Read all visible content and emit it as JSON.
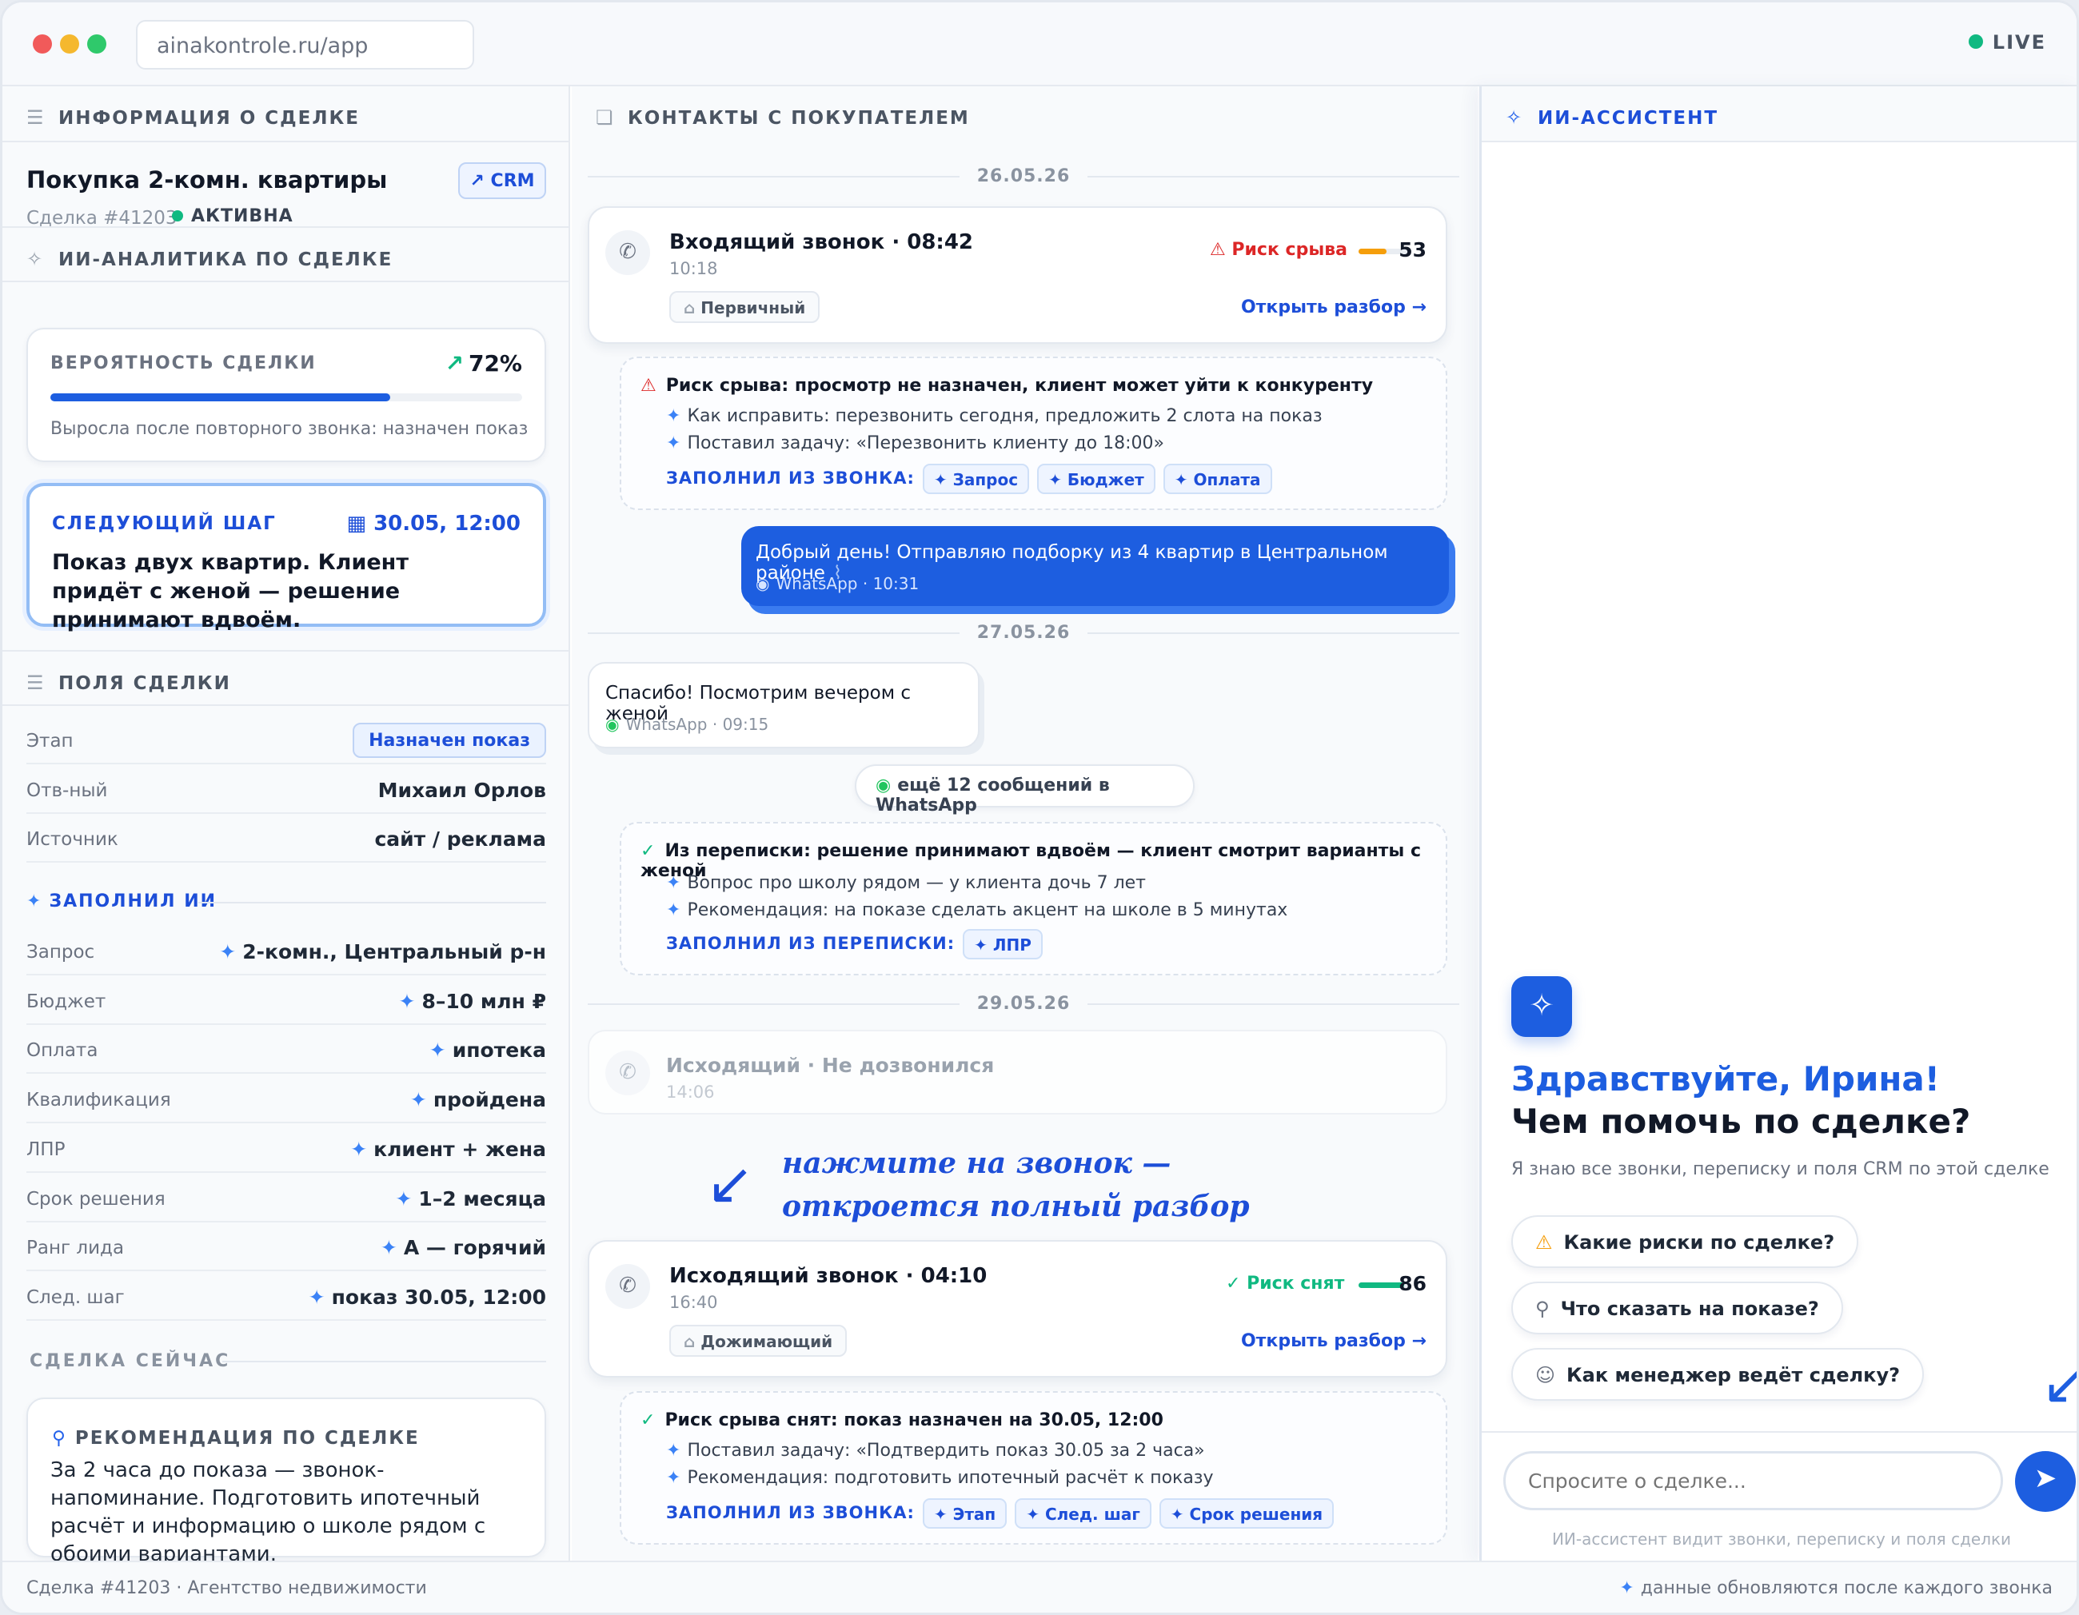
{
  "window": {
    "url": "ainakontrole.ru/app",
    "live_label": "LIVE"
  },
  "colors": {
    "accent": "#1d5ee0",
    "success": "#10b981",
    "danger": "#dc2626",
    "warning": "#f59e0b"
  },
  "left": {
    "header": "ИНФОРМАЦИЯ О СДЕЛКЕ",
    "deal_title": "Покупка 2-комн. квартиры",
    "crm_label": "CRM",
    "deal_number": "Сделка #41203",
    "status": "АКТИВНА",
    "analytics_header": "ИИ-АНАЛИТИКА ПО СДЕЛКЕ",
    "probability": {
      "label": "ВЕРОЯТНОСТЬ СДЕЛКИ",
      "value": "72%",
      "fraction": 0.72,
      "note": "Выросла после повторного звонка: назначен показ"
    },
    "next_step": {
      "label": "СЛЕДУЮЩИЙ ШАГ",
      "date": "30.05, 12:00",
      "text": "Показ двух квартир. Клиент придёт с женой — решение принимают вдвоём."
    },
    "fields_header": "ПОЛЯ СДЕЛКИ",
    "fields": [
      {
        "key": "Этап",
        "value": "Назначен показ"
      },
      {
        "key": "Отв-ный",
        "value": "Михаил Орлов"
      },
      {
        "key": "Источник",
        "value": "сайт / реклама"
      }
    ],
    "ai_filled_label": "ЗАПОЛНИЛ ИИ",
    "ai_fields": [
      {
        "key": "Запрос",
        "value": "2-комн., Центральный р-н"
      },
      {
        "key": "Бюджет",
        "value": "8–10 млн ₽"
      },
      {
        "key": "Оплата",
        "value": "ипотека"
      },
      {
        "key": "Квалификация",
        "value": "пройдена"
      },
      {
        "key": "ЛПР",
        "value": "клиент + жена"
      },
      {
        "key": "Срок решения",
        "value": "1–2 месяца"
      },
      {
        "key": "Ранг лида",
        "value": "A — горячий"
      },
      {
        "key": "След. шаг",
        "value": "показ 30.05, 12:00"
      }
    ],
    "now_label": "СДЕЛКА СЕЙЧАС",
    "recommendation": {
      "label": "РЕКОМЕНДАЦИЯ ПО СДЕЛКЕ",
      "text": "За 2 часа до показа — звонок-напоминание. Подготовить ипотечный расчёт и информацию о школе рядом с обоими вариантами."
    }
  },
  "middle": {
    "header": "КОНТАКТЫ С ПОКУПАТЕЛЕМ",
    "dates": [
      "26.05.26",
      "27.05.26",
      "29.05.26"
    ],
    "call1": {
      "title": "Входящий звонок · 08:42",
      "time": "10:18",
      "tag": "Первичный",
      "risk_label": "Риск срыва",
      "risk_value": "53",
      "risk_fraction": 0.53,
      "open": "Открыть разбор →"
    },
    "insight1": {
      "title": "Риск срыва: просмотр не назначен, клиент может уйти к конкуренту",
      "lines": [
        "Как исправить: перезвонить сегодня, предложить 2 слота на показ",
        "Поставил задачу: «Перезвонить клиенту до 18:00»"
      ],
      "filled_label": "ЗАПОЛНИЛ ИЗ ЗВОНКА:",
      "chips": [
        "Запрос",
        "Бюджет",
        "Оплата"
      ]
    },
    "out_msg": {
      "text": "Добрый день! Отправляю подборку из 4 квартир в Центральном районе",
      "meta": "WhatsApp · 10:31"
    },
    "in_msg": {
      "text": "Спасибо! Посмотрим вечером с женой",
      "meta": "WhatsApp · 09:15"
    },
    "more_wa": "ещё 12 сообщений в WhatsApp",
    "insight2": {
      "title": "Из переписки: решение принимают вдвоём — клиент смотрит варианты с женой",
      "lines": [
        "Вопрос про школу рядом — у клиента дочь 7 лет",
        "Рекомендация: на показе сделать акцент на школе в 5 минутах"
      ],
      "filled_label": "ЗАПОЛНИЛ ИЗ ПЕРЕПИСКИ:",
      "chips": [
        "ЛПР"
      ]
    },
    "missed": {
      "title": "Исходящий · Не дозвонился",
      "time": "14:06"
    },
    "hint": {
      "line1": "нажмите на звонок —",
      "line2": "откроется полный разбор"
    },
    "call2": {
      "title": "Исходящий звонок · 04:10",
      "time": "16:40",
      "tag": "Дожимающий",
      "risk_label": "Риск снят",
      "risk_value": "86",
      "risk_fraction": 0.86,
      "open": "Открыть разбор →"
    },
    "insight3": {
      "title": "Риск срыва снят: показ назначен на 30.05, 12:00",
      "lines": [
        "Поставил задачу: «Подтвердить показ 30.05 за 2 часа»",
        "Рекомендация: подготовить ипотечный расчёт к показу"
      ],
      "filled_label": "ЗАПОЛНИЛ ИЗ ЗВОНКА:",
      "chips": [
        "Этап",
        "След. шаг",
        "Срок решения"
      ]
    }
  },
  "right": {
    "header": "ИИ-АССИСТЕНТ",
    "greeting_name": "Здравствуйте, Ирина!",
    "greeting_question": "Чем помочь по сделке?",
    "greeting_sub": "Я знаю все звонки, переписку и поля CRM по этой сделке",
    "quick_questions": [
      "Какие риски по сделке?",
      "Что сказать на показе?",
      "Как менеджер ведёт сделку?"
    ],
    "input_placeholder": "Спросите о сделке...",
    "note": "ИИ-ассистент видит звонки, переписку и поля сделки"
  },
  "footer": {
    "left": "Сделка #41203 · Агентство недвижимости",
    "right": "данные обновляются после каждого звонка"
  }
}
